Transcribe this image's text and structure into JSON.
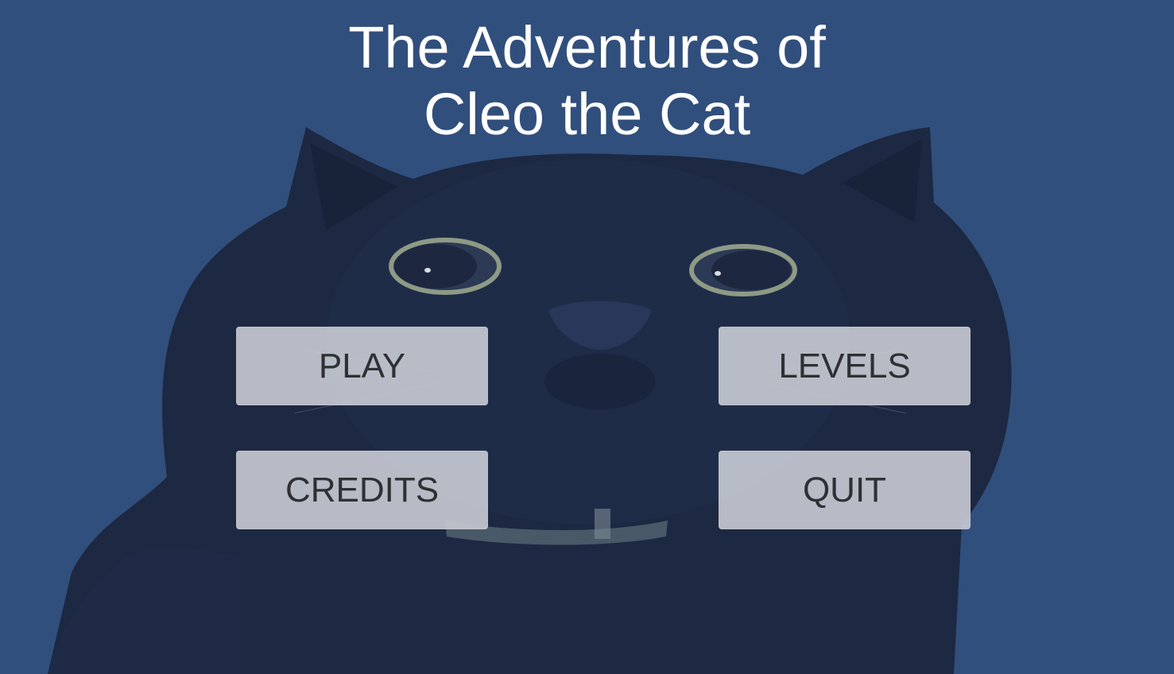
{
  "title": {
    "line1": "The Adventures of",
    "line2": "Cleo the Cat"
  },
  "menu": {
    "play": "PLAY",
    "levels": "LEVELS",
    "credits": "CREDITS",
    "quit": "QUIT"
  },
  "colors": {
    "background": "#314f7c",
    "cat_fur": "#1c2740",
    "button_bg": "#c4c7d0",
    "button_text": "#2f3034",
    "title_text": "#ffffff"
  }
}
